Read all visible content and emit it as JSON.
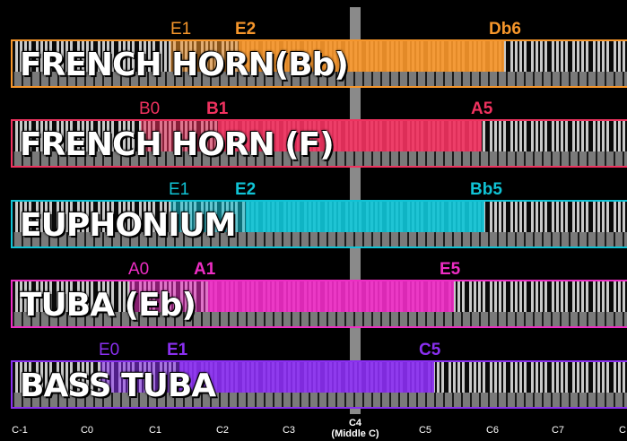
{
  "instruments": [
    {
      "name": "FRENCH HORN(Bb)",
      "color": "#f6962b",
      "ext_low": "E1",
      "low": "E2",
      "high": "Db6"
    },
    {
      "name": "FRENCH HORN (F)",
      "color": "#f0325f",
      "ext_low": "B0",
      "low": "B1",
      "high": "A5"
    },
    {
      "name": "EUPHONIUM",
      "color": "#10c3d5",
      "ext_low": "E1",
      "low": "E2",
      "high": "Bb5"
    },
    {
      "name": "TUBA (Eb)",
      "color": "#ee2dc4",
      "ext_low": "A0",
      "low": "A1",
      "high": "E5"
    },
    {
      "name": "BASS TUBA",
      "color": "#8a2ff0",
      "ext_low": "E0",
      "low": "E1",
      "high": "C5"
    }
  ],
  "octaves": [
    {
      "label": "C-1"
    },
    {
      "label": "C0"
    },
    {
      "label": "C1"
    },
    {
      "label": "C2"
    },
    {
      "label": "C3"
    },
    {
      "label": "C4",
      "sub": "(Middle C)"
    },
    {
      "label": "C5"
    },
    {
      "label": "C6"
    },
    {
      "label": "C7"
    },
    {
      "label": "C"
    }
  ]
}
